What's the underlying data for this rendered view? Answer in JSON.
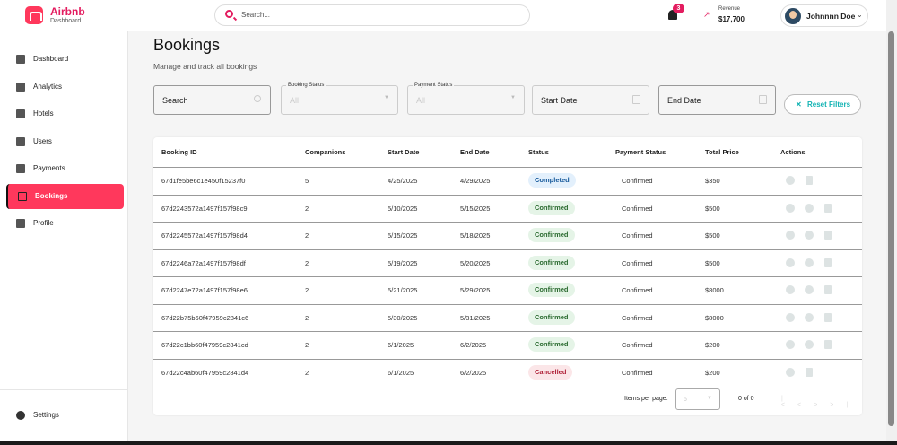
{
  "header": {
    "brand": "Airbnb",
    "brand_sub": "Dashboard",
    "search_placeholder": "Search...",
    "notifications": "3",
    "revenue_label": "Revenue",
    "revenue_value": "$17,700",
    "user_name": "Johnnnn Doe"
  },
  "sidebar": {
    "items": [
      {
        "label": "Dashboard",
        "icon": "dashboard-icon"
      },
      {
        "label": "Analytics",
        "icon": "analytics-icon"
      },
      {
        "label": "Hotels",
        "icon": "hotel-icon"
      },
      {
        "label": "Users",
        "icon": "users-icon"
      },
      {
        "label": "Payments",
        "icon": "payments-icon"
      },
      {
        "label": "Bookings",
        "icon": "calendar-icon",
        "active": true
      },
      {
        "label": "Profile",
        "icon": "profile-icon"
      }
    ],
    "settings": "Settings"
  },
  "page": {
    "title": "Bookings",
    "subtitle": "Manage and track all bookings"
  },
  "filters": {
    "search": "Search",
    "booking_status_label": "Booking Status",
    "booking_status_value": "All",
    "payment_status_label": "Payment Status",
    "payment_status_value": "All",
    "start_date": "Start Date",
    "end_date": "End Date",
    "reset": "Reset Filters"
  },
  "table": {
    "columns": [
      "Booking ID",
      "Companions",
      "Start Date",
      "End Date",
      "Status",
      "Payment Status",
      "Total Price",
      "Actions"
    ],
    "rows": [
      [
        "67d1fe5be6c1e450f15237f0",
        "5",
        "4/25/2025",
        "4/29/2025",
        "Completed",
        "Confirmed",
        "$350"
      ],
      [
        "67d2243572a1497f157f98c9",
        "2",
        "5/10/2025",
        "5/15/2025",
        "Confirmed",
        "Confirmed",
        "$500"
      ],
      [
        "67d2245572a1497f157f98d4",
        "2",
        "5/15/2025",
        "5/18/2025",
        "Confirmed",
        "Confirmed",
        "$500"
      ],
      [
        "67d2246a72a1497f157f98df",
        "2",
        "5/19/2025",
        "5/20/2025",
        "Confirmed",
        "Confirmed",
        "$500"
      ],
      [
        "67d2247e72a1497f157f98e6",
        "2",
        "5/21/2025",
        "5/29/2025",
        "Confirmed",
        "Confirmed",
        "$8000"
      ],
      [
        "67d22b75b60f47959c2841c6",
        "2",
        "5/30/2025",
        "5/31/2025",
        "Confirmed",
        "Confirmed",
        "$8000"
      ],
      [
        "67d22c1bb60f47959c2841cd",
        "2",
        "6/1/2025",
        "6/2/2025",
        "Confirmed",
        "Confirmed",
        "$200"
      ],
      [
        "67d22c4ab60f47959c2841d4",
        "2",
        "6/1/2025",
        "6/2/2025",
        "Cancelled",
        "Confirmed",
        "$200"
      ]
    ]
  },
  "pagination": {
    "label": "Items per page:",
    "per_page": "5",
    "range": "0 of 0"
  }
}
